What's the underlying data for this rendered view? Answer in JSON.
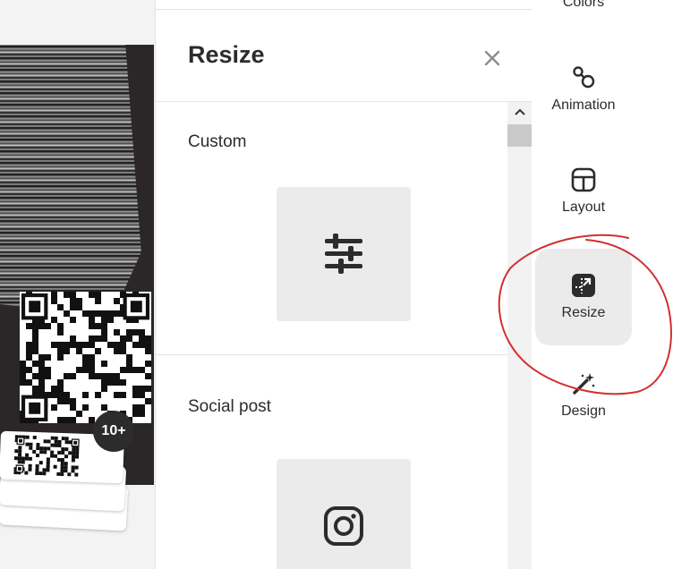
{
  "canvas": {
    "badge_count": "10+"
  },
  "panel": {
    "title": "Resize",
    "sections": [
      {
        "label": "Custom",
        "icon": "sliders-icon"
      },
      {
        "label": "Social post",
        "icon": "instagram-icon"
      }
    ]
  },
  "right_bar": {
    "items": [
      {
        "label": "Colors",
        "icon": "colors-icon"
      },
      {
        "label": "Animation",
        "icon": "animation-icon"
      },
      {
        "label": "Layout",
        "icon": "layout-icon"
      },
      {
        "label": "Resize",
        "icon": "resize-icon",
        "active": true
      },
      {
        "label": "Design",
        "icon": "magic-wand-icon"
      }
    ]
  },
  "colors": {
    "annotation": "#d32f2f",
    "active_bg": "#ebebeb",
    "text": "#2c2c2c"
  }
}
